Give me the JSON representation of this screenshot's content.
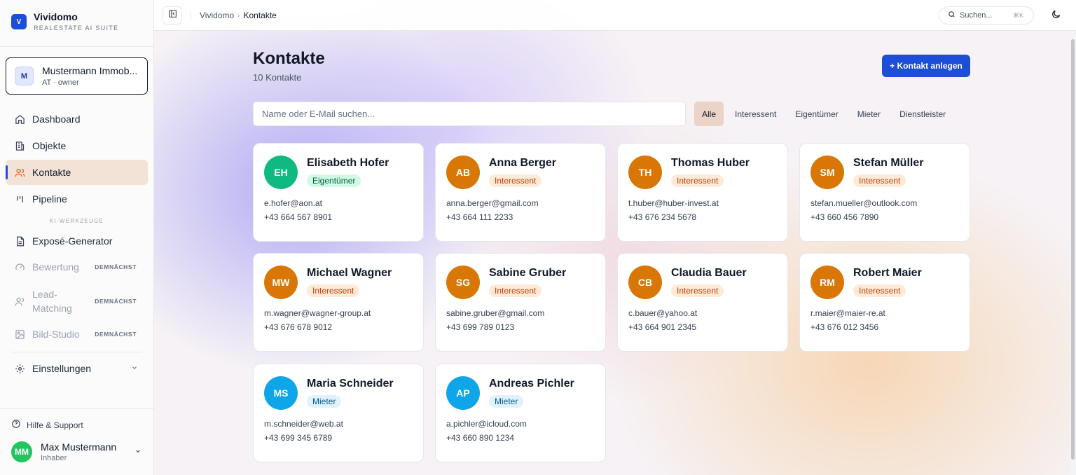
{
  "brand": {
    "logo": "V",
    "name": "Vividomo",
    "subtitle": "REALESTATE AI SUITE"
  },
  "org": {
    "avatar": "M",
    "name": "Mustermann Immob...",
    "meta": "AT · owner"
  },
  "nav": {
    "dashboard": "Dashboard",
    "objekte": "Objekte",
    "kontakte": "Kontakte",
    "pipeline": "Pipeline",
    "section_ai": "KI-WERKZEUGE",
    "expose": "Exposé-Generator",
    "bewertung": "Bewertung",
    "lead_matching_1": "Lead-",
    "lead_matching_2": "Matching",
    "bild_studio": "Bild-Studio",
    "soon": "DEMNÄCHST",
    "einstellungen": "Einstellungen"
  },
  "footer": {
    "help": "Hilfe & Support",
    "user_initials": "MM",
    "user_name": "Max Mustermann",
    "user_role": "Inhaber"
  },
  "topbar": {
    "crumb_root": "Vividomo",
    "crumb_sep": "›",
    "crumb_current": "Kontakte",
    "search_label": "Suchen...",
    "search_kbd": "⌘K"
  },
  "page": {
    "title": "Kontakte",
    "count": "10 Kontakte",
    "add_button": "+ Kontakt anlegen",
    "search_placeholder": "Name oder E-Mail suchen...",
    "filters": [
      "Alle",
      "Interessent",
      "Eigentümer",
      "Mieter",
      "Dienstleister"
    ],
    "active_filter": "Alle"
  },
  "colors": {
    "accent": "#1d4ed8",
    "owner": "#10b981",
    "interest": "#d97706",
    "tenant": "#0ea5e9"
  },
  "contacts": [
    {
      "initials": "EH",
      "name": "Elisabeth Hofer",
      "role": "Eigentümer",
      "email": "e.hofer@aon.at",
      "phone": "+43 664 567 8901",
      "color": "#10b981"
    },
    {
      "initials": "AB",
      "name": "Anna Berger",
      "role": "Interessent",
      "email": "anna.berger@gmail.com",
      "phone": "+43 664 111 2233",
      "color": "#d97706"
    },
    {
      "initials": "TH",
      "name": "Thomas Huber",
      "role": "Interessent",
      "email": "t.huber@huber-invest.at",
      "phone": "+43 676 234 5678",
      "color": "#d97706"
    },
    {
      "initials": "SM",
      "name": "Stefan Müller",
      "role": "Interessent",
      "email": "stefan.mueller@outlook.com",
      "phone": "+43 660 456 7890",
      "color": "#d97706"
    },
    {
      "initials": "MW",
      "name": "Michael Wagner",
      "role": "Interessent",
      "email": "m.wagner@wagner-group.at",
      "phone": "+43 676 678 9012",
      "color": "#d97706"
    },
    {
      "initials": "SG",
      "name": "Sabine Gruber",
      "role": "Interessent",
      "email": "sabine.gruber@gmail.com",
      "phone": "+43 699 789 0123",
      "color": "#d97706"
    },
    {
      "initials": "CB",
      "name": "Claudia Bauer",
      "role": "Interessent",
      "email": "c.bauer@yahoo.at",
      "phone": "+43 664 901 2345",
      "color": "#d97706"
    },
    {
      "initials": "RM",
      "name": "Robert Maier",
      "role": "Interessent",
      "email": "r.maier@maier-re.at",
      "phone": "+43 676 012 3456",
      "color": "#d97706"
    },
    {
      "initials": "MS",
      "name": "Maria Schneider",
      "role": "Mieter",
      "email": "m.schneider@web.at",
      "phone": "+43 699 345 6789",
      "color": "#0ea5e9"
    },
    {
      "initials": "AP",
      "name": "Andreas Pichler",
      "role": "Mieter",
      "email": "a.pichler@icloud.com",
      "phone": "+43 660 890 1234",
      "color": "#0ea5e9"
    }
  ]
}
